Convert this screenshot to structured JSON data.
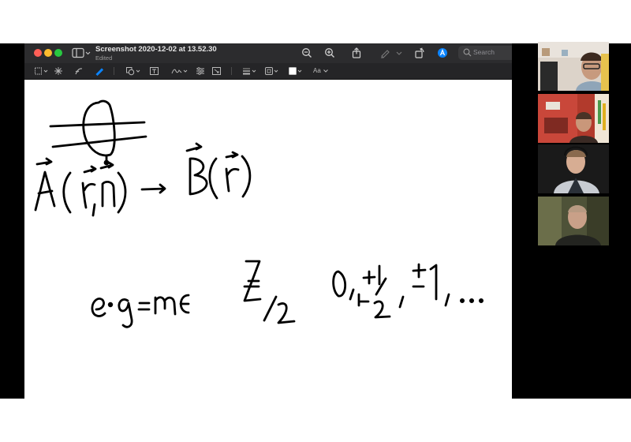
{
  "window": {
    "title": "Screenshot 2020-12-02 at 13.52.30",
    "status": "Edited",
    "search_placeholder": "Search"
  },
  "toolbar": {
    "icons": [
      "sidebar-icon",
      "zoom-out-icon",
      "zoom-in-icon",
      "share-icon",
      "highlight-icon",
      "rotate-icon",
      "markup-icon",
      "search-icon"
    ]
  },
  "markup_toolbar": {
    "icons": [
      "selection-icon",
      "instant-alpha-icon",
      "sketch-icon",
      "draw-icon",
      "shapes-icon",
      "text-icon",
      "sign-icon",
      "adjust-color-icon",
      "adjust-size-icon",
      "shape-style-icon",
      "border-color-icon",
      "fill-color-icon",
      "text-style-icon"
    ],
    "text_style_label": "Aa"
  },
  "participants": [
    {
      "name": "participant-1"
    },
    {
      "name": "participant-2"
    },
    {
      "name": "participant-3"
    },
    {
      "name": "participant-4"
    }
  ],
  "colors": {
    "titlebar": "#2c2c2e",
    "markupbar": "#252527",
    "accent_markup": "#0a84ff",
    "ink": "#000000"
  }
}
